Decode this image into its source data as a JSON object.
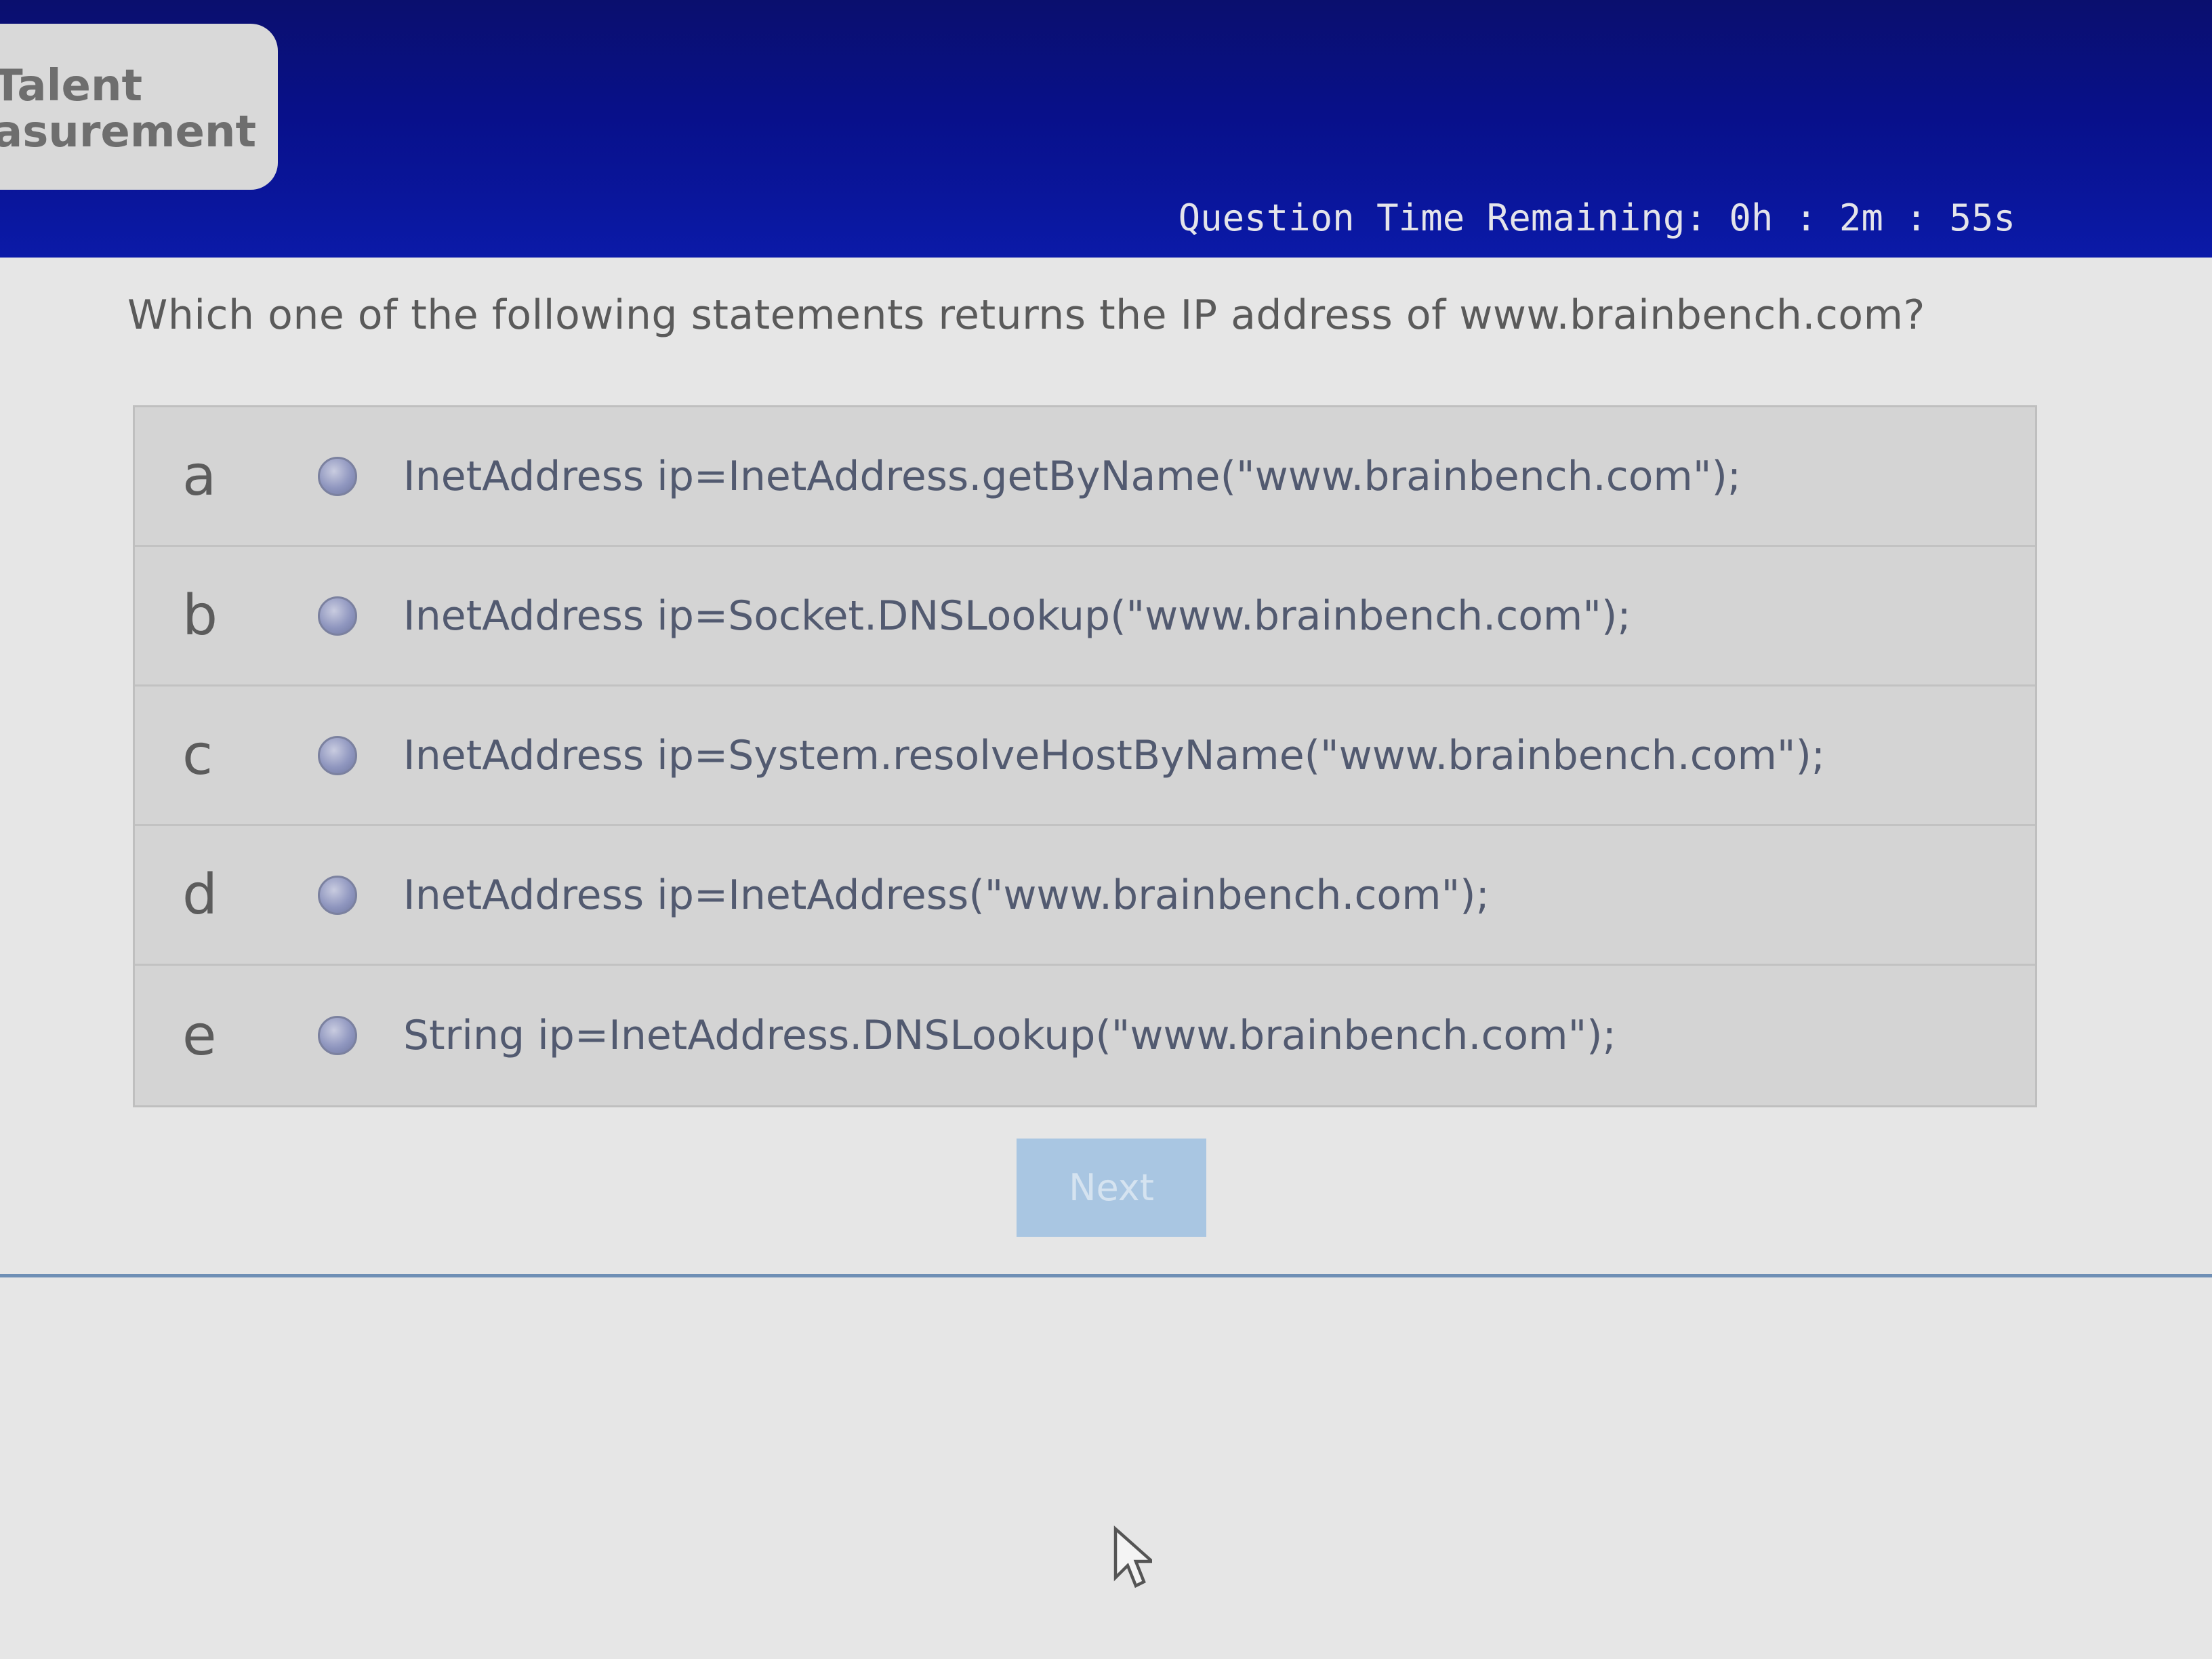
{
  "header": {
    "logo": {
      "line1": "Talent",
      "line2": "asurement"
    },
    "timer": "Question Time Remaining: 0h : 2m : 55s"
  },
  "question": {
    "text": "Which one of the following statements returns the IP address of www.brainbench.com?"
  },
  "answers": [
    {
      "letter": "a",
      "text": "InetAddress ip=InetAddress.getByName(\"www.brainbench.com\");"
    },
    {
      "letter": "b",
      "text": "InetAddress ip=Socket.DNSLookup(\"www.brainbench.com\");"
    },
    {
      "letter": "c",
      "text": "InetAddress ip=System.resolveHostByName(\"www.brainbench.com\");"
    },
    {
      "letter": "d",
      "text": "InetAddress ip=InetAddress(\"www.brainbench.com\");"
    },
    {
      "letter": "e",
      "text": "String ip=InetAddress.DNSLookup(\"www.brainbench.com\");"
    }
  ],
  "next_button": {
    "label": "Next",
    "enabled": false
  },
  "colors": {
    "header_bg": "#08108a",
    "page_bg": "#e6e6e6",
    "answers_bg": "#d4d4d4",
    "next_button_bg": "#a9c6e2"
  }
}
